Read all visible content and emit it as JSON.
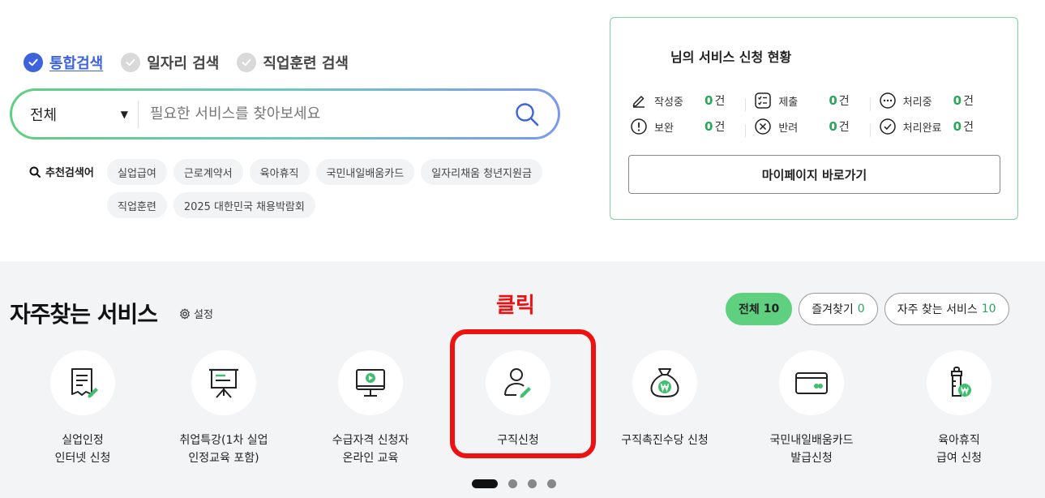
{
  "search_tabs": [
    {
      "label": "통합검색",
      "active": true
    },
    {
      "label": "일자리 검색",
      "active": false
    },
    {
      "label": "직업훈련 검색",
      "active": false
    }
  ],
  "search": {
    "scope_value": "전체",
    "placeholder": "필요한 서비스를 찾아보세요",
    "value": ""
  },
  "recommended": {
    "label": "추천검색어",
    "chips": [
      "실업급여",
      "근로계약서",
      "육아휴직",
      "국민내일배움카드",
      "일자리채움 청년지원금",
      "직업훈련",
      "2025 대한민국 채용박람회"
    ]
  },
  "status_card": {
    "title": "님의 서비스 신청 현황",
    "unit": "건",
    "rows": [
      [
        {
          "icon": "pencil-icon",
          "label": "작성중",
          "count": "0"
        },
        {
          "icon": "checklist-icon",
          "label": "제출",
          "count": "0"
        },
        {
          "icon": "ellipsis-circle-icon",
          "label": "처리중",
          "count": "0"
        }
      ],
      [
        {
          "icon": "exclamation-circle-icon",
          "label": "보완",
          "count": "0"
        },
        {
          "icon": "x-circle-icon",
          "label": "반려",
          "count": "0"
        },
        {
          "icon": "check-circle-icon",
          "label": "처리완료",
          "count": "0"
        }
      ]
    ],
    "mypage_button": "마이페이지 바로가기"
  },
  "frequent": {
    "title": "자주찾는 서비스",
    "settings_label": "설정",
    "filters": [
      {
        "label": "전체",
        "count": "10",
        "active": true
      },
      {
        "label": "즐겨찾기",
        "count": "0",
        "active": false
      },
      {
        "label": "자주 찾는 서비스",
        "count": "10",
        "active": false
      }
    ],
    "services": [
      {
        "icon": "document-pen-icon",
        "name": "실업인정\n인터넷 신청"
      },
      {
        "icon": "presentation-board-icon",
        "name": "취업특강(1차 실업\n인정교육 포함)"
      },
      {
        "icon": "monitor-play-icon",
        "name": "수급자격 신청자\n온라인 교육"
      },
      {
        "icon": "person-pen-icon",
        "name": "구직신청"
      },
      {
        "icon": "money-bag-won-icon",
        "name": "구직촉진수당 신청"
      },
      {
        "icon": "card-icon",
        "name": "국민내일배움카드\n발급신청"
      },
      {
        "icon": "baby-bottle-won-icon",
        "name": "육아휴직\n급여 신청"
      }
    ],
    "pagination": {
      "pages": 4,
      "current": 1
    }
  },
  "annotation": {
    "label": "클릭",
    "color": "#ee1111"
  },
  "colors": {
    "accent_green": "#5fcf80",
    "count_green": "#2aa65a",
    "accent_blue": "#3d63dd"
  }
}
